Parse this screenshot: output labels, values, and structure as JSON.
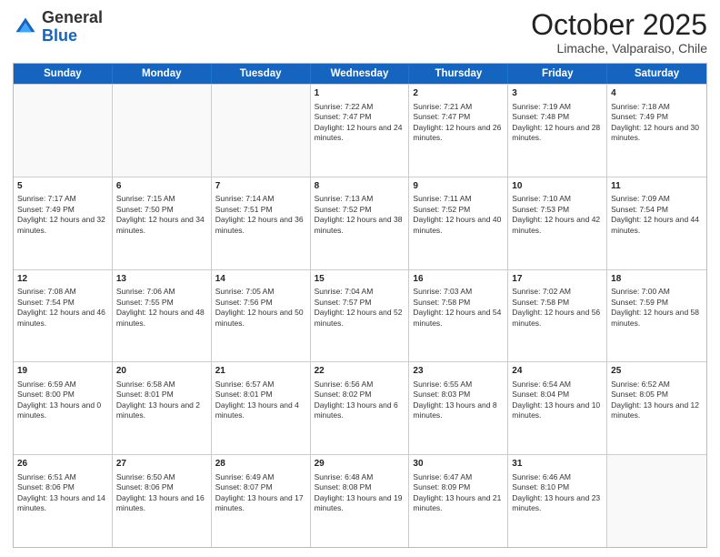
{
  "header": {
    "logo": {
      "line1": "General",
      "line2": "Blue"
    },
    "title": "October 2025",
    "subtitle": "Limache, Valparaiso, Chile"
  },
  "days_of_week": [
    "Sunday",
    "Monday",
    "Tuesday",
    "Wednesday",
    "Thursday",
    "Friday",
    "Saturday"
  ],
  "weeks": [
    [
      {
        "day": "",
        "sunrise": "",
        "sunset": "",
        "daylight": "",
        "empty": true
      },
      {
        "day": "",
        "sunrise": "",
        "sunset": "",
        "daylight": "",
        "empty": true
      },
      {
        "day": "",
        "sunrise": "",
        "sunset": "",
        "daylight": "",
        "empty": true
      },
      {
        "day": "1",
        "sunrise": "Sunrise: 7:22 AM",
        "sunset": "Sunset: 7:47 PM",
        "daylight": "Daylight: 12 hours and 24 minutes."
      },
      {
        "day": "2",
        "sunrise": "Sunrise: 7:21 AM",
        "sunset": "Sunset: 7:47 PM",
        "daylight": "Daylight: 12 hours and 26 minutes."
      },
      {
        "day": "3",
        "sunrise": "Sunrise: 7:19 AM",
        "sunset": "Sunset: 7:48 PM",
        "daylight": "Daylight: 12 hours and 28 minutes."
      },
      {
        "day": "4",
        "sunrise": "Sunrise: 7:18 AM",
        "sunset": "Sunset: 7:49 PM",
        "daylight": "Daylight: 12 hours and 30 minutes."
      }
    ],
    [
      {
        "day": "5",
        "sunrise": "Sunrise: 7:17 AM",
        "sunset": "Sunset: 7:49 PM",
        "daylight": "Daylight: 12 hours and 32 minutes."
      },
      {
        "day": "6",
        "sunrise": "Sunrise: 7:15 AM",
        "sunset": "Sunset: 7:50 PM",
        "daylight": "Daylight: 12 hours and 34 minutes."
      },
      {
        "day": "7",
        "sunrise": "Sunrise: 7:14 AM",
        "sunset": "Sunset: 7:51 PM",
        "daylight": "Daylight: 12 hours and 36 minutes."
      },
      {
        "day": "8",
        "sunrise": "Sunrise: 7:13 AM",
        "sunset": "Sunset: 7:52 PM",
        "daylight": "Daylight: 12 hours and 38 minutes."
      },
      {
        "day": "9",
        "sunrise": "Sunrise: 7:11 AM",
        "sunset": "Sunset: 7:52 PM",
        "daylight": "Daylight: 12 hours and 40 minutes."
      },
      {
        "day": "10",
        "sunrise": "Sunrise: 7:10 AM",
        "sunset": "Sunset: 7:53 PM",
        "daylight": "Daylight: 12 hours and 42 minutes."
      },
      {
        "day": "11",
        "sunrise": "Sunrise: 7:09 AM",
        "sunset": "Sunset: 7:54 PM",
        "daylight": "Daylight: 12 hours and 44 minutes."
      }
    ],
    [
      {
        "day": "12",
        "sunrise": "Sunrise: 7:08 AM",
        "sunset": "Sunset: 7:54 PM",
        "daylight": "Daylight: 12 hours and 46 minutes."
      },
      {
        "day": "13",
        "sunrise": "Sunrise: 7:06 AM",
        "sunset": "Sunset: 7:55 PM",
        "daylight": "Daylight: 12 hours and 48 minutes."
      },
      {
        "day": "14",
        "sunrise": "Sunrise: 7:05 AM",
        "sunset": "Sunset: 7:56 PM",
        "daylight": "Daylight: 12 hours and 50 minutes."
      },
      {
        "day": "15",
        "sunrise": "Sunrise: 7:04 AM",
        "sunset": "Sunset: 7:57 PM",
        "daylight": "Daylight: 12 hours and 52 minutes."
      },
      {
        "day": "16",
        "sunrise": "Sunrise: 7:03 AM",
        "sunset": "Sunset: 7:58 PM",
        "daylight": "Daylight: 12 hours and 54 minutes."
      },
      {
        "day": "17",
        "sunrise": "Sunrise: 7:02 AM",
        "sunset": "Sunset: 7:58 PM",
        "daylight": "Daylight: 12 hours and 56 minutes."
      },
      {
        "day": "18",
        "sunrise": "Sunrise: 7:00 AM",
        "sunset": "Sunset: 7:59 PM",
        "daylight": "Daylight: 12 hours and 58 minutes."
      }
    ],
    [
      {
        "day": "19",
        "sunrise": "Sunrise: 6:59 AM",
        "sunset": "Sunset: 8:00 PM",
        "daylight": "Daylight: 13 hours and 0 minutes."
      },
      {
        "day": "20",
        "sunrise": "Sunrise: 6:58 AM",
        "sunset": "Sunset: 8:01 PM",
        "daylight": "Daylight: 13 hours and 2 minutes."
      },
      {
        "day": "21",
        "sunrise": "Sunrise: 6:57 AM",
        "sunset": "Sunset: 8:01 PM",
        "daylight": "Daylight: 13 hours and 4 minutes."
      },
      {
        "day": "22",
        "sunrise": "Sunrise: 6:56 AM",
        "sunset": "Sunset: 8:02 PM",
        "daylight": "Daylight: 13 hours and 6 minutes."
      },
      {
        "day": "23",
        "sunrise": "Sunrise: 6:55 AM",
        "sunset": "Sunset: 8:03 PM",
        "daylight": "Daylight: 13 hours and 8 minutes."
      },
      {
        "day": "24",
        "sunrise": "Sunrise: 6:54 AM",
        "sunset": "Sunset: 8:04 PM",
        "daylight": "Daylight: 13 hours and 10 minutes."
      },
      {
        "day": "25",
        "sunrise": "Sunrise: 6:52 AM",
        "sunset": "Sunset: 8:05 PM",
        "daylight": "Daylight: 13 hours and 12 minutes."
      }
    ],
    [
      {
        "day": "26",
        "sunrise": "Sunrise: 6:51 AM",
        "sunset": "Sunset: 8:06 PM",
        "daylight": "Daylight: 13 hours and 14 minutes."
      },
      {
        "day": "27",
        "sunrise": "Sunrise: 6:50 AM",
        "sunset": "Sunset: 8:06 PM",
        "daylight": "Daylight: 13 hours and 16 minutes."
      },
      {
        "day": "28",
        "sunrise": "Sunrise: 6:49 AM",
        "sunset": "Sunset: 8:07 PM",
        "daylight": "Daylight: 13 hours and 17 minutes."
      },
      {
        "day": "29",
        "sunrise": "Sunrise: 6:48 AM",
        "sunset": "Sunset: 8:08 PM",
        "daylight": "Daylight: 13 hours and 19 minutes."
      },
      {
        "day": "30",
        "sunrise": "Sunrise: 6:47 AM",
        "sunset": "Sunset: 8:09 PM",
        "daylight": "Daylight: 13 hours and 21 minutes."
      },
      {
        "day": "31",
        "sunrise": "Sunrise: 6:46 AM",
        "sunset": "Sunset: 8:10 PM",
        "daylight": "Daylight: 13 hours and 23 minutes."
      },
      {
        "day": "",
        "sunrise": "",
        "sunset": "",
        "daylight": "",
        "empty": true
      }
    ]
  ]
}
